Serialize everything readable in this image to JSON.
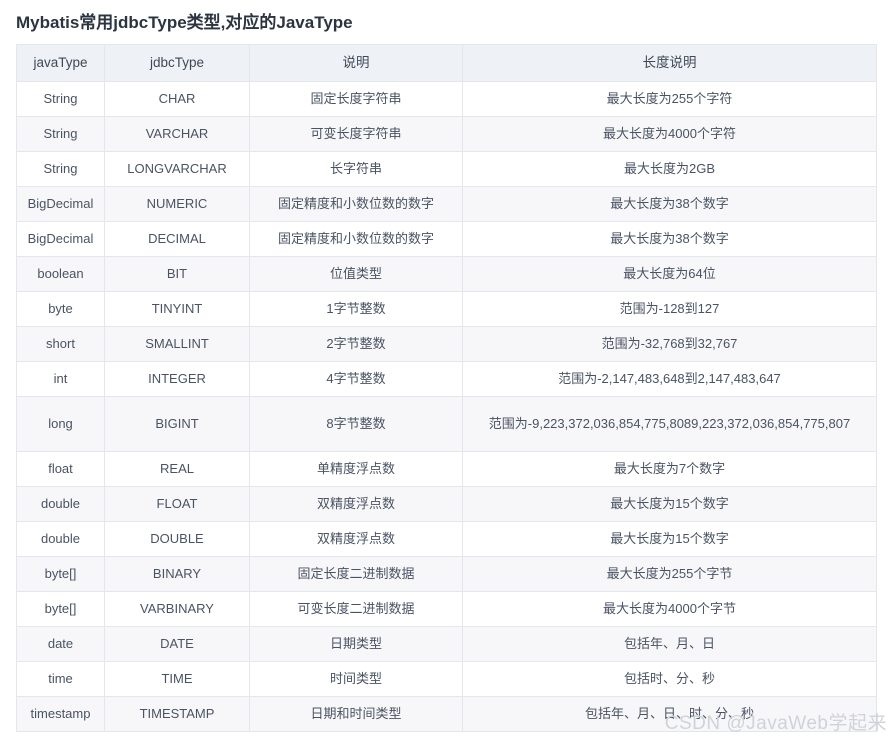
{
  "page": {
    "title": "Mybatis常用jdbcType类型,对应的JavaType"
  },
  "watermark": {
    "text": "CSDN @JavaWeb学起来",
    "color": "#cfd3d8"
  },
  "theme": {
    "header_bg": "#eef2f6",
    "row_even_bg": "#ffffff",
    "row_odd_bg": "#f7f7f9",
    "border_color": "#e3e6eb",
    "text_color": "#4a5363",
    "title_color": "#2b3440"
  },
  "table": {
    "columns": [
      {
        "key": "javaType",
        "label": "javaType"
      },
      {
        "key": "jdbcType",
        "label": "jdbcType"
      },
      {
        "key": "desc",
        "label": "说明"
      },
      {
        "key": "length",
        "label": "长度说明"
      }
    ],
    "rows": [
      {
        "javaType": "String",
        "jdbcType": "CHAR",
        "desc": "固定长度字符串",
        "length": "最大长度为255个字符"
      },
      {
        "javaType": "String",
        "jdbcType": "VARCHAR",
        "desc": "可变长度字符串",
        "length": "最大长度为4000个字符"
      },
      {
        "javaType": "String",
        "jdbcType": "LONGVARCHAR",
        "desc": "长字符串",
        "length": "最大长度为2GB"
      },
      {
        "javaType": "BigDecimal",
        "jdbcType": "NUMERIC",
        "desc": "固定精度和小数位数的数字",
        "length": "最大长度为38个数字"
      },
      {
        "javaType": "BigDecimal",
        "jdbcType": "DECIMAL",
        "desc": "固定精度和小数位数的数字",
        "length": "最大长度为38个数字"
      },
      {
        "javaType": "boolean",
        "jdbcType": "BIT",
        "desc": "位值类型",
        "length": "最大长度为64位"
      },
      {
        "javaType": "byte",
        "jdbcType": "TINYINT",
        "desc": "1字节整数",
        "length": "范围为-128到127"
      },
      {
        "javaType": "short",
        "jdbcType": "SMALLINT",
        "desc": "2字节整数",
        "length": "范围为-32,768到32,767"
      },
      {
        "javaType": "int",
        "jdbcType": "INTEGER",
        "desc": "4字节整数",
        "length": "范围为-2,147,483,648到2,147,483,647"
      },
      {
        "javaType": "long",
        "jdbcType": "BIGINT",
        "desc": "8字节整数",
        "length": "范围为-9,223,372,036,854,775,8089,223,372,036,854,775,807",
        "tall": true
      },
      {
        "javaType": "float",
        "jdbcType": "REAL",
        "desc": "单精度浮点数",
        "length": "最大长度为7个数字"
      },
      {
        "javaType": "double",
        "jdbcType": "FLOAT",
        "desc": "双精度浮点数",
        "length": "最大长度为15个数字"
      },
      {
        "javaType": "double",
        "jdbcType": "DOUBLE",
        "desc": "双精度浮点数",
        "length": "最大长度为15个数字"
      },
      {
        "javaType": "byte[]",
        "jdbcType": "BINARY",
        "desc": "固定长度二进制数据",
        "length": "最大长度为255个字节"
      },
      {
        "javaType": "byte[]",
        "jdbcType": "VARBINARY",
        "desc": "可变长度二进制数据",
        "length": "最大长度为4000个字节"
      },
      {
        "javaType": "date",
        "jdbcType": "DATE",
        "desc": "日期类型",
        "length": "包括年、月、日"
      },
      {
        "javaType": "time",
        "jdbcType": "TIME",
        "desc": "时间类型",
        "length": "包括时、分、秒"
      },
      {
        "javaType": "timestamp",
        "jdbcType": "TIMESTAMP",
        "desc": "日期和时间类型",
        "length": "包括年、月、日、时、分、秒"
      }
    ]
  }
}
